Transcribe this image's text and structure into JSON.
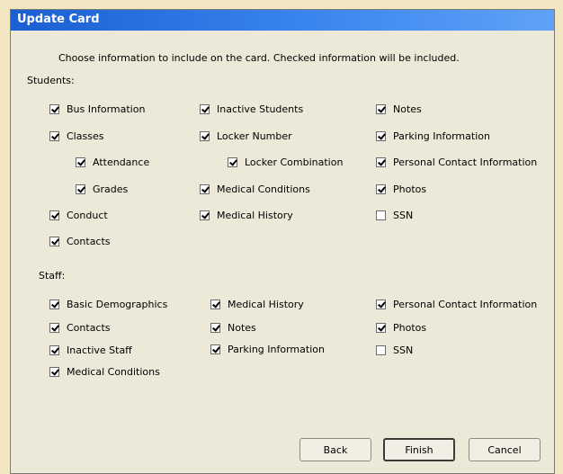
{
  "window": {
    "title": "Update Card"
  },
  "instructions": "Choose information to include on the card.  Checked information will be included.",
  "students": {
    "section_label": "Students:",
    "col1": [
      {
        "label": "Bus Information",
        "checked": true
      },
      {
        "label": "Classes",
        "checked": true
      },
      {
        "label": "Attendance",
        "checked": true
      },
      {
        "label": "Grades",
        "checked": true
      },
      {
        "label": "Conduct",
        "checked": true
      },
      {
        "label": "Contacts",
        "checked": true
      }
    ],
    "col2": [
      {
        "label": "Inactive Students",
        "checked": true
      },
      {
        "label": "Locker Number",
        "checked": true
      },
      {
        "label": "Locker Combination",
        "checked": true
      },
      {
        "label": "Medical Conditions",
        "checked": true
      },
      {
        "label": "Medical History",
        "checked": true
      }
    ],
    "col3": [
      {
        "label": "Notes",
        "checked": true
      },
      {
        "label": "Parking Information",
        "checked": true
      },
      {
        "label": "Personal Contact Information",
        "checked": true
      },
      {
        "label": "Photos",
        "checked": true
      },
      {
        "label": "SSN",
        "checked": false
      }
    ]
  },
  "staff": {
    "section_label": "Staff:",
    "col1": [
      {
        "label": "Basic Demographics",
        "checked": true
      },
      {
        "label": "Contacts",
        "checked": true
      },
      {
        "label": "Inactive Staff",
        "checked": true
      },
      {
        "label": "Medical Conditions",
        "checked": true
      }
    ],
    "col2": [
      {
        "label": "Medical History",
        "checked": true
      },
      {
        "label": "Notes",
        "checked": true
      },
      {
        "label": "Parking Information",
        "checked": true
      }
    ],
    "col3": [
      {
        "label": "Personal Contact Information",
        "checked": true
      },
      {
        "label": "Photos",
        "checked": true
      },
      {
        "label": "SSN",
        "checked": false
      }
    ]
  },
  "buttons": {
    "back": "Back",
    "finish": "Finish",
    "cancel": "Cancel"
  }
}
